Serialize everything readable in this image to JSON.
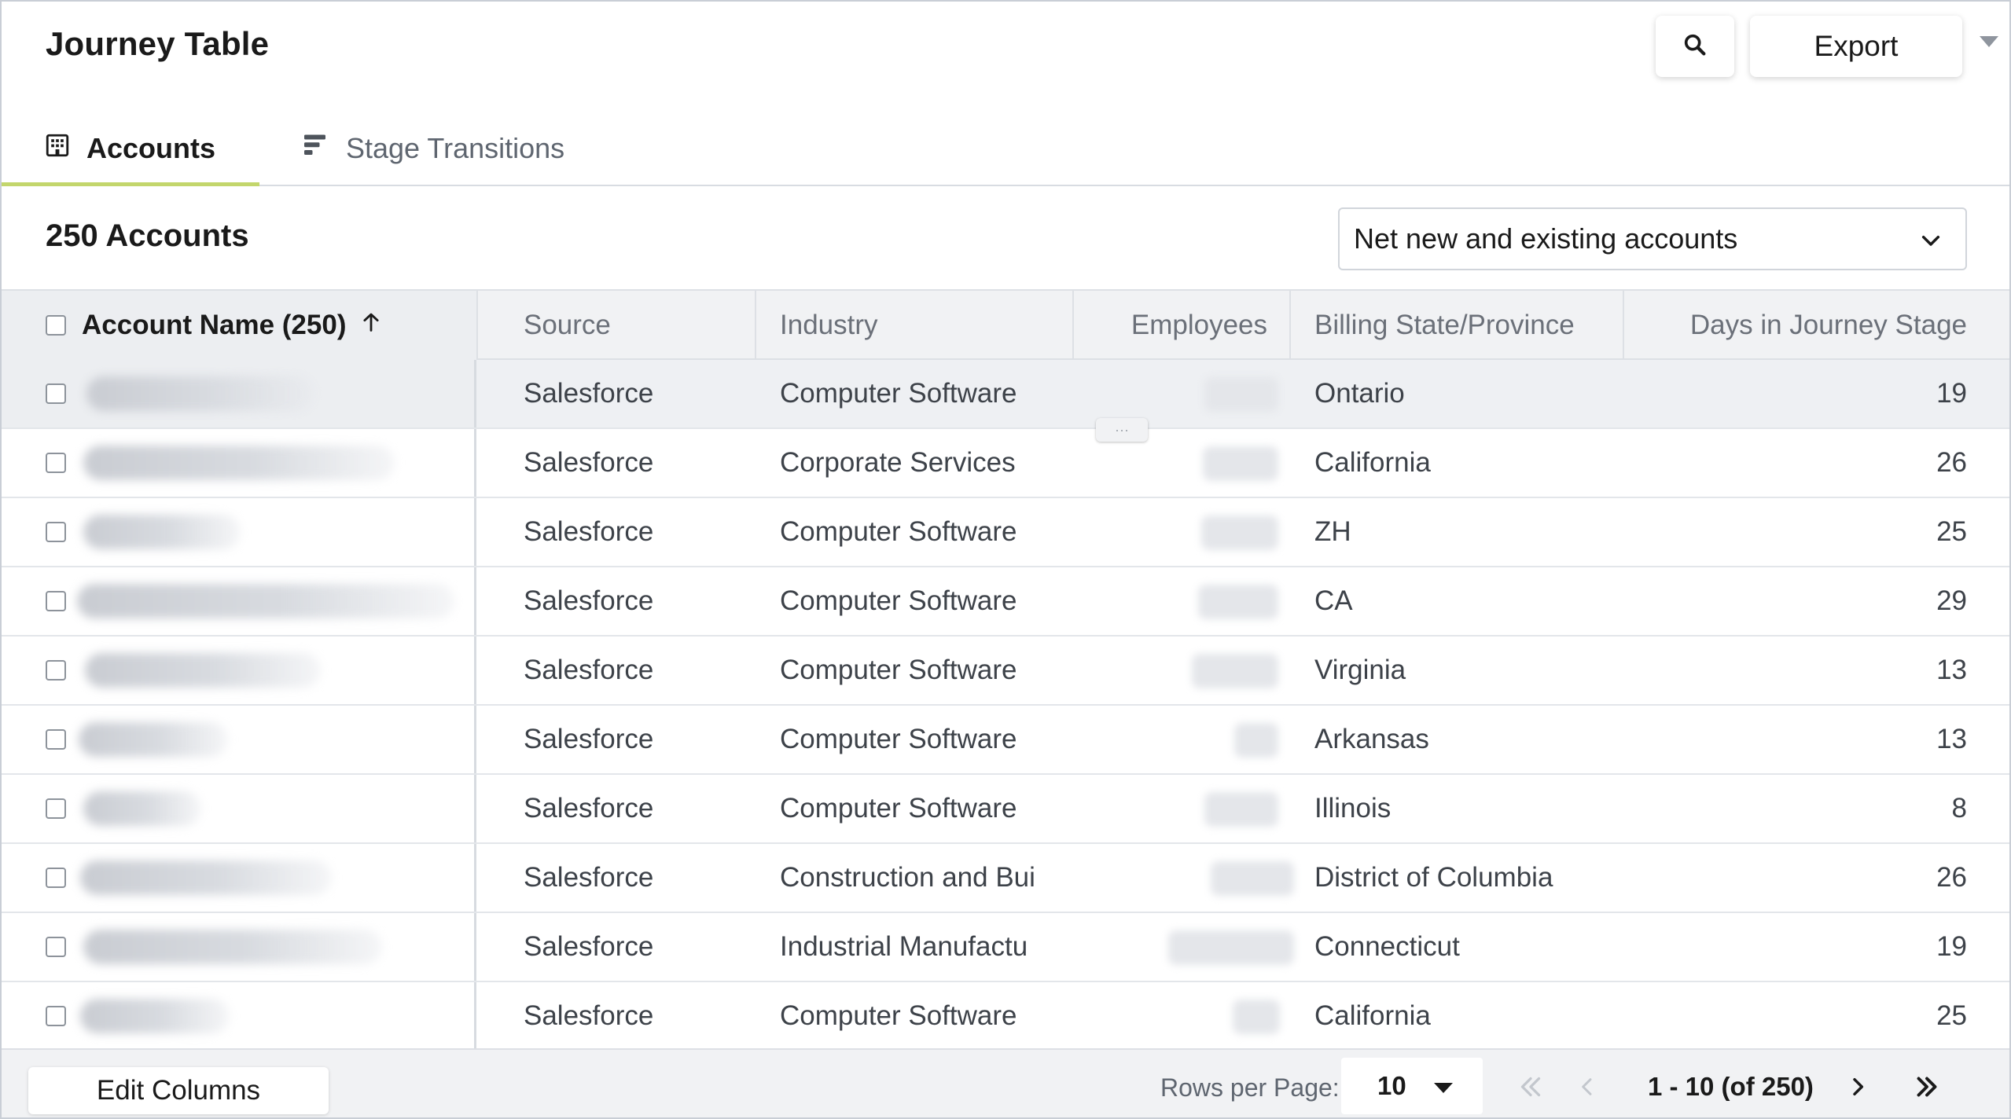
{
  "header": {
    "title": "Journey Table",
    "export_label": "Export"
  },
  "tabs": [
    {
      "label": "Accounts",
      "icon": "building-icon",
      "active": true
    },
    {
      "label": "Stage Transitions",
      "icon": "bar-list-icon",
      "active": false
    }
  ],
  "summary": {
    "count_label": "250 Accounts",
    "filter_value": "Net new and existing accounts"
  },
  "table": {
    "columns": {
      "account_name": "Account Name (250)",
      "source": "Source",
      "industry": "Industry",
      "employees": "Employees",
      "billing": "Billing State/Province",
      "days": "Days in Journey Stage"
    },
    "sort": "ascending",
    "rows": [
      {
        "source": "Salesforce",
        "industry": "Computer Software",
        "billing": "Ontario",
        "days": "19"
      },
      {
        "source": "Salesforce",
        "industry": "Corporate Services",
        "billing": "California",
        "days": "26"
      },
      {
        "source": "Salesforce",
        "industry": "Computer Software",
        "billing": "ZH",
        "days": "25"
      },
      {
        "source": "Salesforce",
        "industry": "Computer Software",
        "billing": "CA",
        "days": "29"
      },
      {
        "source": "Salesforce",
        "industry": "Computer Software",
        "billing": "Virginia",
        "days": "13"
      },
      {
        "source": "Salesforce",
        "industry": "Computer Software",
        "billing": "Arkansas",
        "days": "13"
      },
      {
        "source": "Salesforce",
        "industry": "Computer Software",
        "billing": "Illinois",
        "days": "8"
      },
      {
        "source": "Salesforce",
        "industry": "Construction and Bui",
        "billing": "District of Columbia",
        "days": "26"
      },
      {
        "source": "Salesforce",
        "industry": "Industrial Manufactu",
        "billing": "Connecticut",
        "days": "19"
      },
      {
        "source": "Salesforce",
        "industry": "Computer Software",
        "billing": "California",
        "days": "25"
      }
    ]
  },
  "footer": {
    "edit_columns_label": "Edit Columns",
    "rows_per_page_label": "Rows per Page:",
    "rows_per_page_value": "10",
    "range_label": "1 - 10 (of 250)"
  },
  "colors": {
    "accent_underline": "#c3d66c",
    "header_bg": "#f1f2f4",
    "highlight_row": "#eef0f3"
  }
}
